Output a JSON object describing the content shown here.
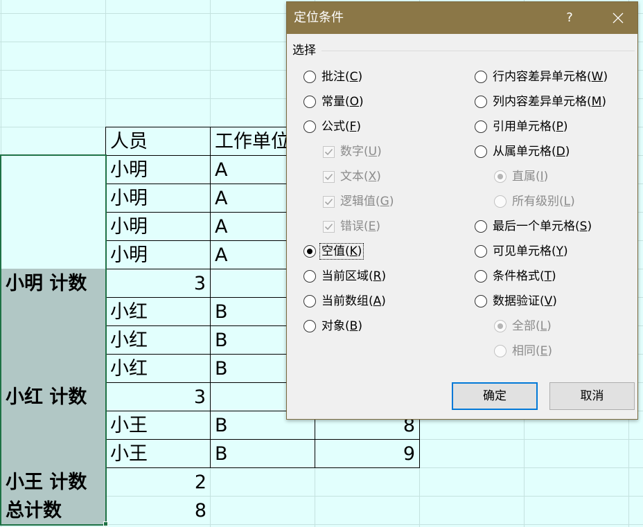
{
  "colors": {
    "sheet_background": "#e2fffd",
    "gridline": "#c4e2df",
    "selection_fill": "#b1c7c5",
    "selection_border": "#1e7145",
    "table_border": "#000000",
    "title_bar": "#8b7747",
    "dialog_background": "#f0f0f0",
    "default_button_border": "#0078d7"
  },
  "sheet": {
    "rows": [
      [
        "",
        "人员",
        "工作单位",
        ""
      ],
      [
        "",
        "小明",
        "A",
        ""
      ],
      [
        "",
        "小明",
        "A",
        ""
      ],
      [
        "",
        "小明",
        "A",
        ""
      ],
      [
        "",
        "小明",
        "A",
        ""
      ],
      [
        "小明 计数",
        "3",
        "",
        ""
      ],
      [
        "",
        "小红",
        "B",
        ""
      ],
      [
        "",
        "小红",
        "B",
        ""
      ],
      [
        "",
        "小红",
        "B",
        ""
      ],
      [
        "小红 计数",
        "3",
        "",
        ""
      ],
      [
        "",
        "小王",
        "B",
        "8"
      ],
      [
        "",
        "小王",
        "B",
        "9"
      ],
      [
        "小王 计数",
        "2",
        "",
        ""
      ],
      [
        "总计数",
        "8",
        "",
        ""
      ]
    ]
  },
  "dialog": {
    "title": "定位条件",
    "help_label": "?",
    "close_icon": "close-icon",
    "group_label": "选择",
    "left_options": [
      {
        "text": "批注(C)",
        "type": "radio",
        "checked": false,
        "enabled": true
      },
      {
        "text": "常量(O)",
        "type": "radio",
        "checked": false,
        "enabled": true
      },
      {
        "text": "公式(F)",
        "type": "radio",
        "checked": false,
        "enabled": true,
        "children": [
          {
            "text": "数字(U)",
            "type": "checkbox",
            "checked": true,
            "enabled": false
          },
          {
            "text": "文本(X)",
            "type": "checkbox",
            "checked": true,
            "enabled": false
          },
          {
            "text": "逻辑值(G)",
            "type": "checkbox",
            "checked": true,
            "enabled": false
          },
          {
            "text": "错误(E)",
            "type": "checkbox",
            "checked": true,
            "enabled": false
          }
        ]
      },
      {
        "text": "空值(K)",
        "type": "radio",
        "checked": true,
        "enabled": true,
        "focused": true
      },
      {
        "text": "当前区域(R)",
        "type": "radio",
        "checked": false,
        "enabled": true
      },
      {
        "text": "当前数组(A)",
        "type": "radio",
        "checked": false,
        "enabled": true
      },
      {
        "text": "对象(B)",
        "type": "radio",
        "checked": false,
        "enabled": true
      }
    ],
    "right_options": [
      {
        "text": "行内容差异单元格(W)",
        "type": "radio",
        "checked": false,
        "enabled": true
      },
      {
        "text": "列内容差异单元格(M)",
        "type": "radio",
        "checked": false,
        "enabled": true
      },
      {
        "text": "引用单元格(P)",
        "type": "radio",
        "checked": false,
        "enabled": true
      },
      {
        "text": "从属单元格(D)",
        "type": "radio",
        "checked": false,
        "enabled": true,
        "children": [
          {
            "text": "直属(I)",
            "type": "radio",
            "checked": true,
            "enabled": false
          },
          {
            "text": "所有级别(L)",
            "type": "radio",
            "checked": false,
            "enabled": false
          }
        ]
      },
      {
        "text": "最后一个单元格(S)",
        "type": "radio",
        "checked": false,
        "enabled": true
      },
      {
        "text": "可见单元格(Y)",
        "type": "radio",
        "checked": false,
        "enabled": true
      },
      {
        "text": "条件格式(T)",
        "type": "radio",
        "checked": false,
        "enabled": true
      },
      {
        "text": "数据验证(V)",
        "type": "radio",
        "checked": false,
        "enabled": true,
        "children": [
          {
            "text": "全部(L)",
            "type": "radio",
            "checked": true,
            "enabled": false
          },
          {
            "text": "相同(E)",
            "type": "radio",
            "checked": false,
            "enabled": false
          }
        ]
      }
    ],
    "ok_label": "确定",
    "cancel_label": "取消"
  }
}
